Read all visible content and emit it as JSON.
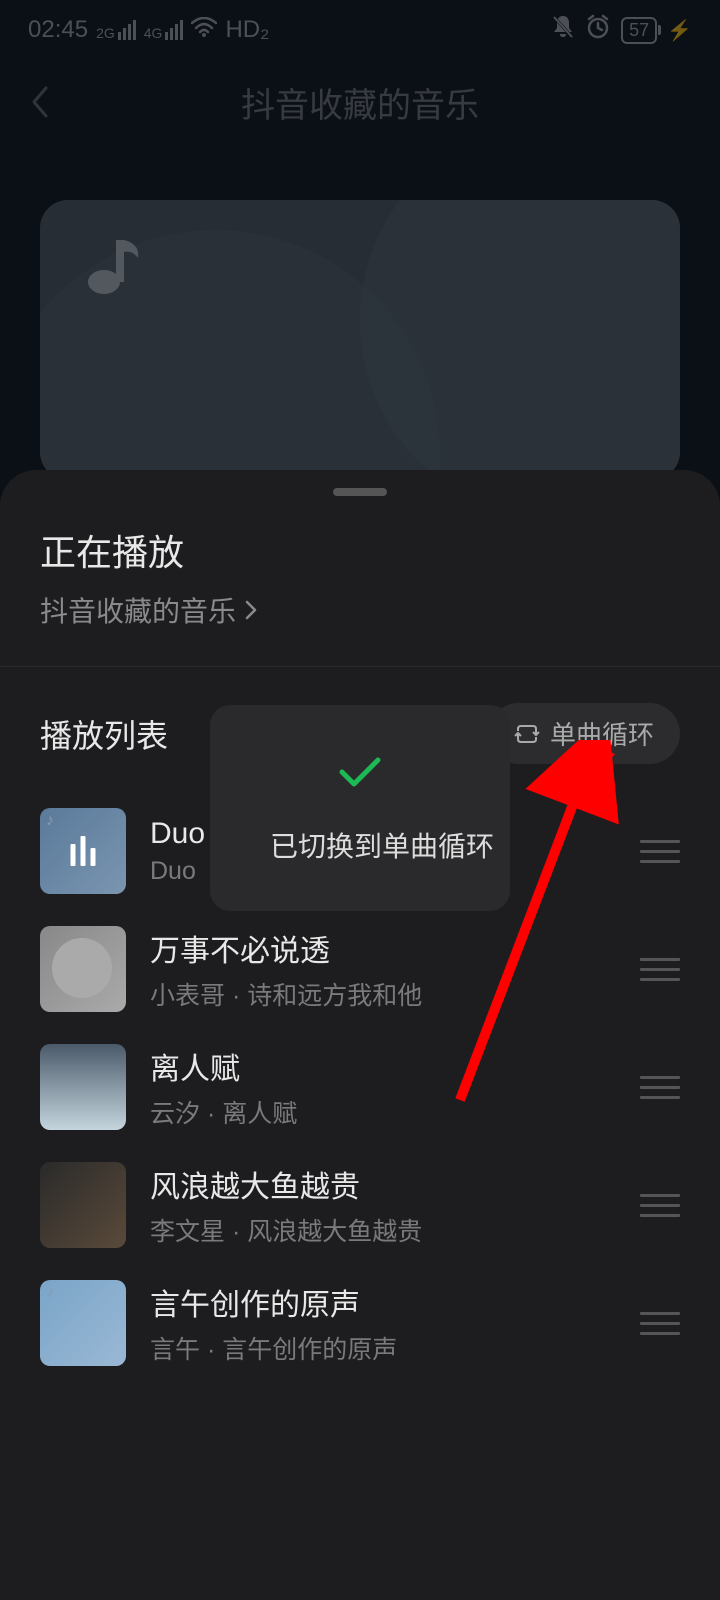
{
  "statusBar": {
    "time": "02:45",
    "net1": "2G",
    "net2": "4G",
    "hd": "HD₂",
    "battery": "57"
  },
  "header": {
    "title": "抖音收藏的音乐"
  },
  "sheet": {
    "nowPlayingTitle": "正在播放",
    "nowPlayingSubtitle": "抖音收藏的音乐",
    "playlistTitle": "播放列表",
    "loopMode": "单曲循环"
  },
  "toast": {
    "message": "已切换到单曲循环"
  },
  "songs": [
    {
      "title": "Duo",
      "artist": "Duo",
      "playing": true
    },
    {
      "title": "万事不必说透",
      "artist": "小表哥 · 诗和远方我和他",
      "playing": false
    },
    {
      "title": "离人赋",
      "artist": "云汐 · 离人赋",
      "playing": false
    },
    {
      "title": "风浪越大鱼越贵",
      "artist": "李文星 · 风浪越大鱼越贵",
      "playing": false
    },
    {
      "title": "言午创作的原声",
      "artist": "言午 · 言午创作的原声",
      "playing": false
    }
  ]
}
